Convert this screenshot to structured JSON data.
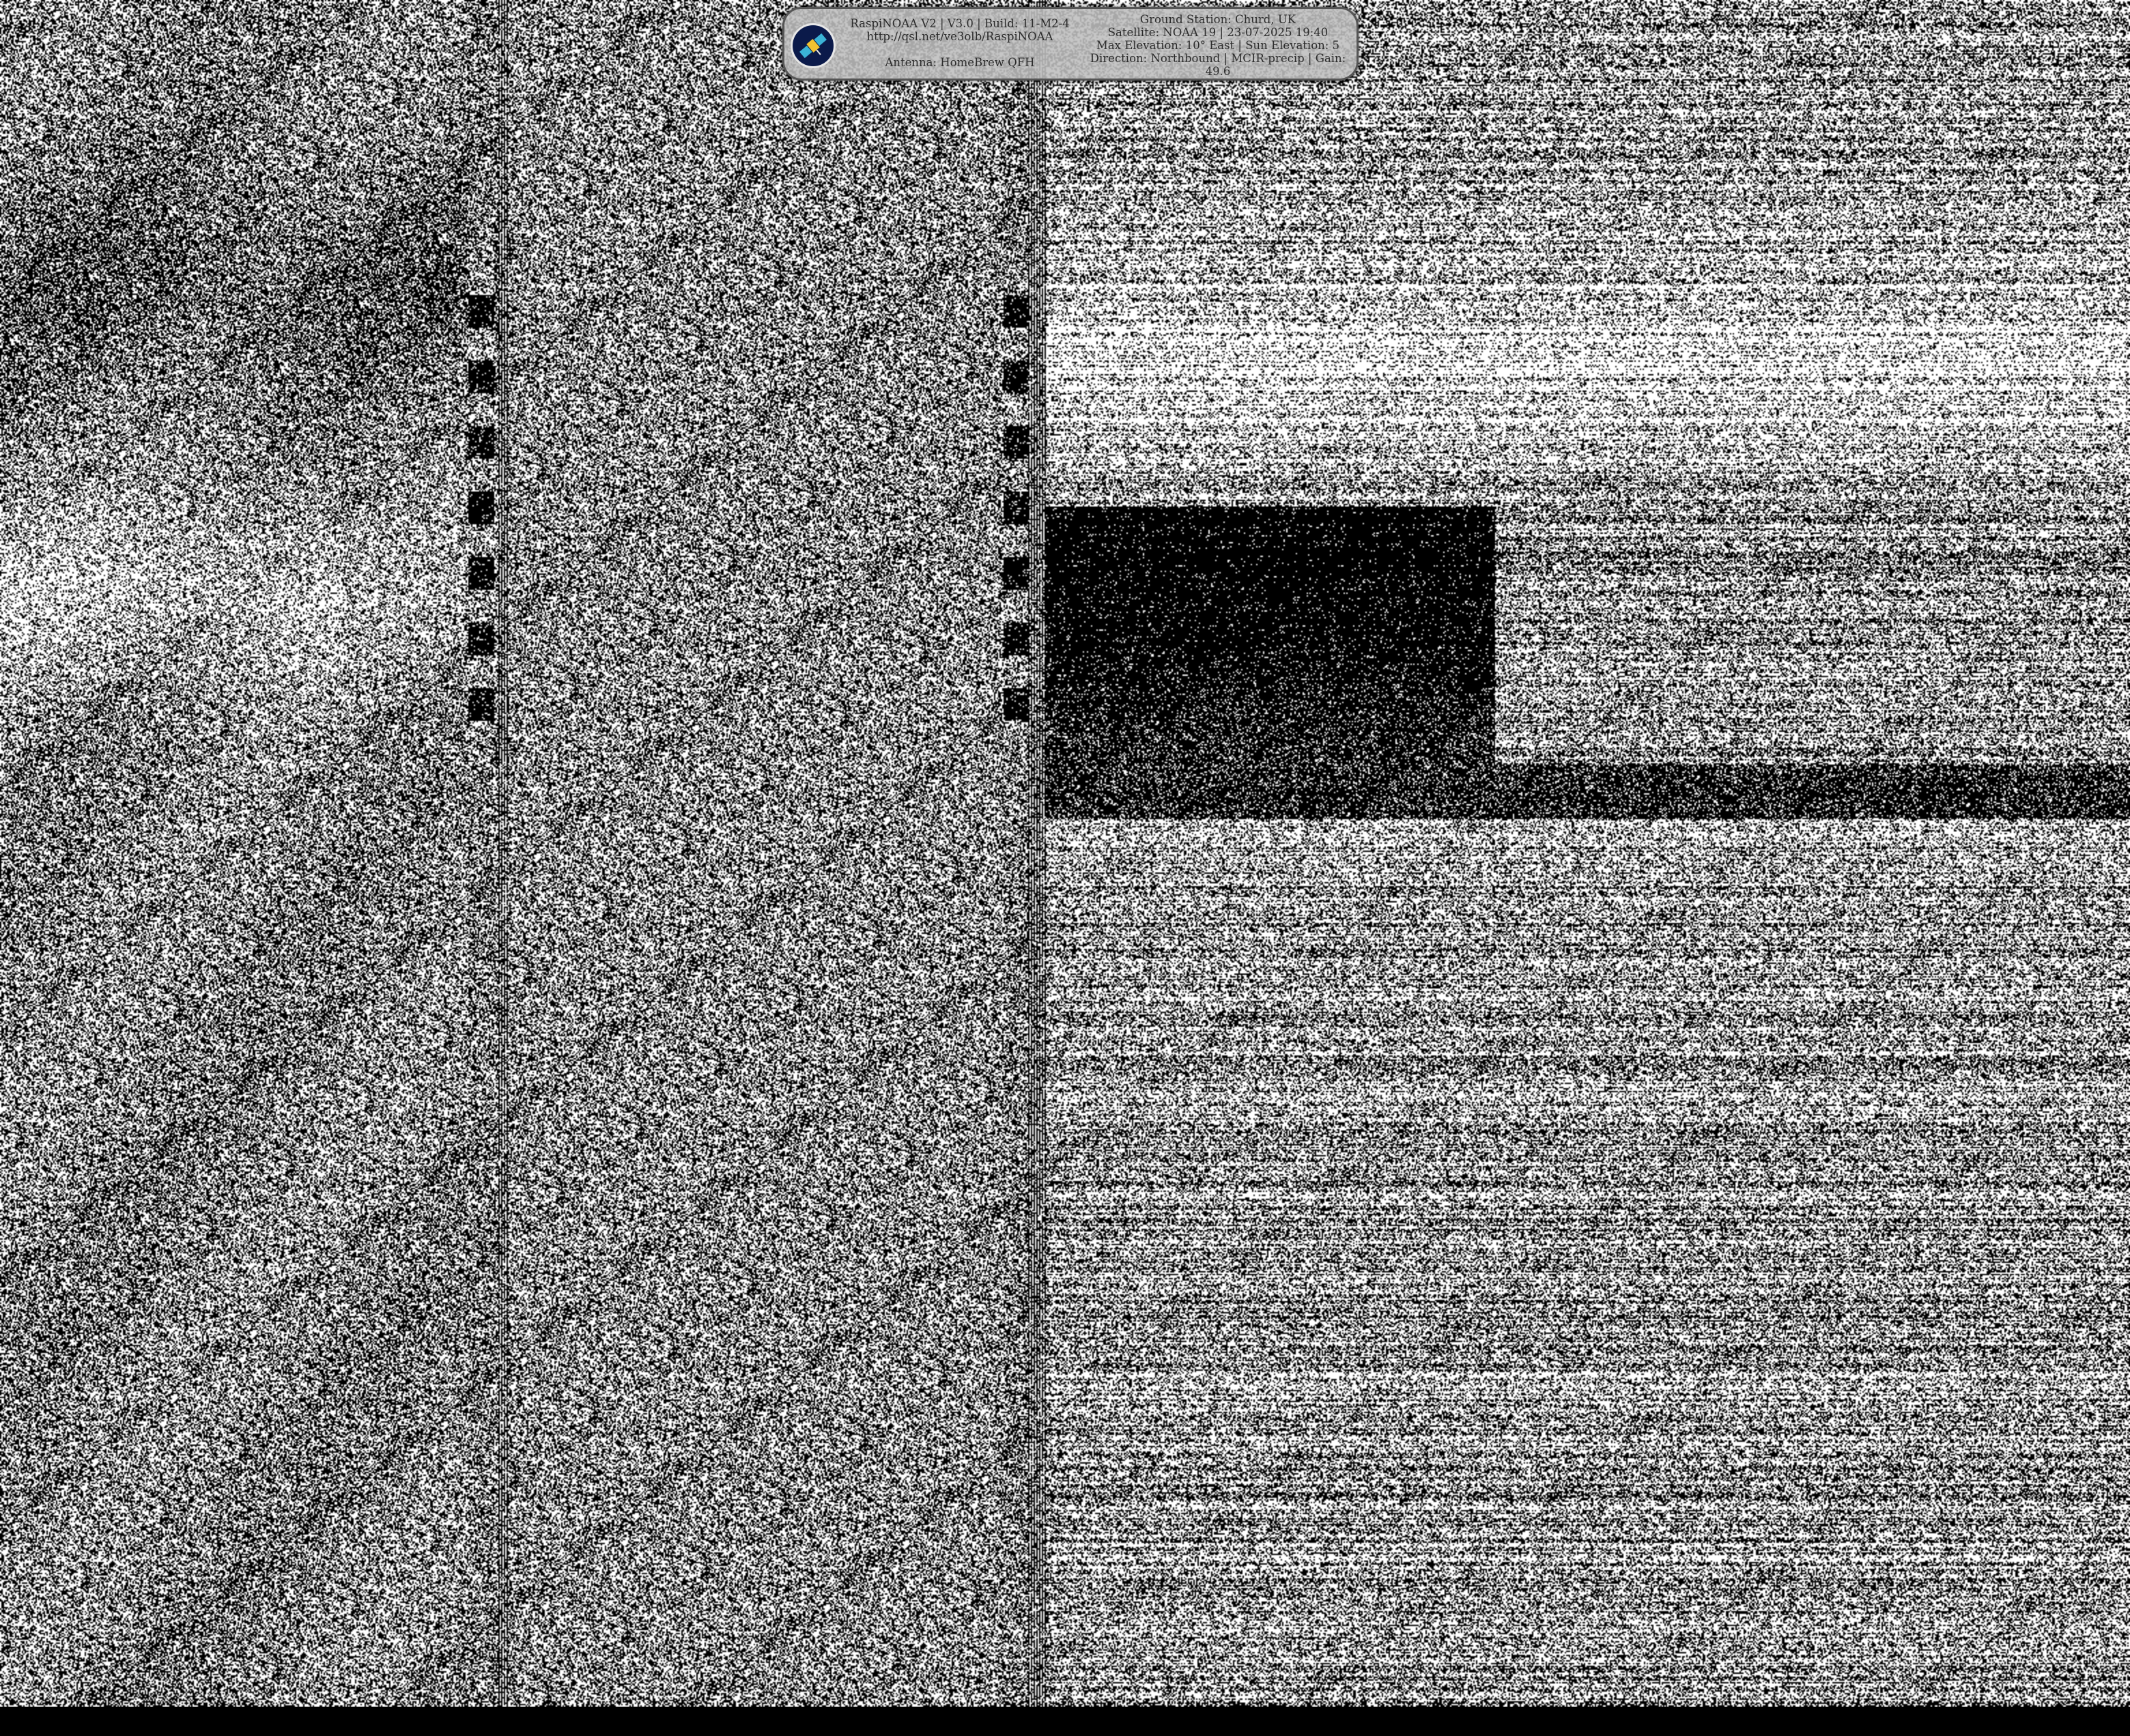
{
  "header": {
    "software_line": "RaspiNOAA V2 | V3.0 | Build: 11-M2-4",
    "url": "http://qsl.net/ve3olb/RaspiNOAA",
    "antenna": "Antenna: HomeBrew QFH",
    "ground_station": "Ground Station: Churd, UK",
    "satellite": "Satellite: NOAA 19 | 23-07-2025 19:40",
    "elevation": "Max Elevation: 10° East | Sun Elevation: 5",
    "direction": "Direction: Northbound | MCIR-precip | Gain: 49.6",
    "logo_icon": "satellite-logo-icon"
  },
  "colors": {
    "panel": "#bebebe",
    "logo_ring": "#0b1a4a",
    "logo_accent": "#3bb3d6",
    "logo_secondary": "#f2c230"
  }
}
